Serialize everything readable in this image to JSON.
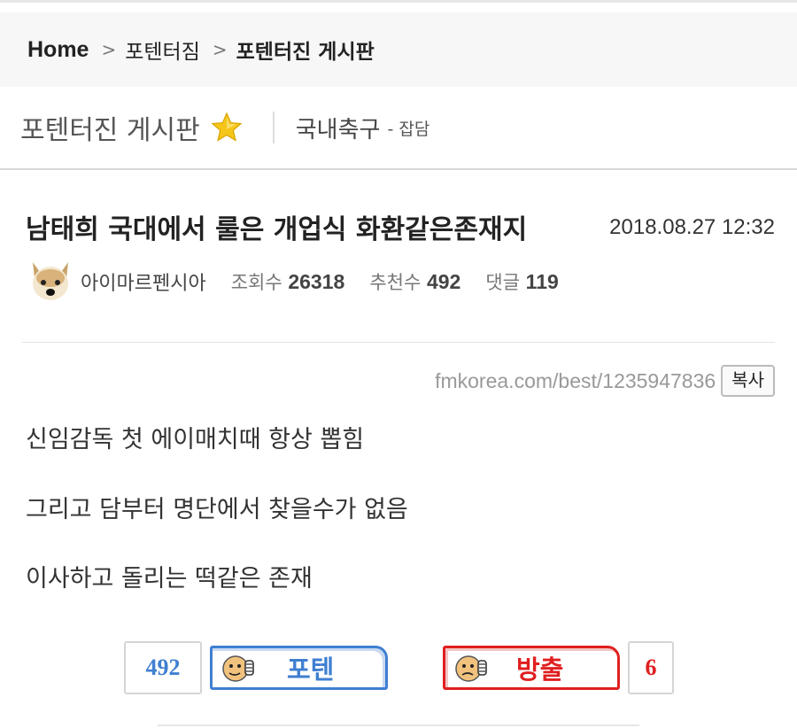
{
  "breadcrumb": {
    "home": "Home",
    "section": "포텐터짐",
    "current": "포텐터진 게시판"
  },
  "board": {
    "title": "포텐터진 게시판",
    "category": "국내축구",
    "subcategory": "- 잡담"
  },
  "post": {
    "title": "남태희 국대에서 룰은 개업식 화환같은존재지",
    "date": "2018.08.27 12:32",
    "author": "아이마르펜시아",
    "views_label": "조회수",
    "views": "26318",
    "recommends_label": "추천수",
    "recommends": "492",
    "comments_label": "댓글",
    "comments": "119",
    "url": "fmkorea.com/best/1235947836",
    "copy_label": "복사",
    "body": [
      "신임감독 첫 에이매치때 항상 뽑힘",
      "그리고 담부터 명단에서 찾을수가 없음",
      "이사하고 돌리는 떡같은 존재"
    ]
  },
  "vote": {
    "up_count": "492",
    "up_label": "포텐",
    "down_label": "방출",
    "down_count": "6"
  },
  "colors": {
    "up": "#3f7fd1",
    "down": "#e02020",
    "star": "#f5c518"
  },
  "icons": {
    "star": "star-icon",
    "avatar": "dog-avatar",
    "up_face": "thumbs-up-face-icon",
    "down_face": "thumbs-down-face-icon"
  }
}
